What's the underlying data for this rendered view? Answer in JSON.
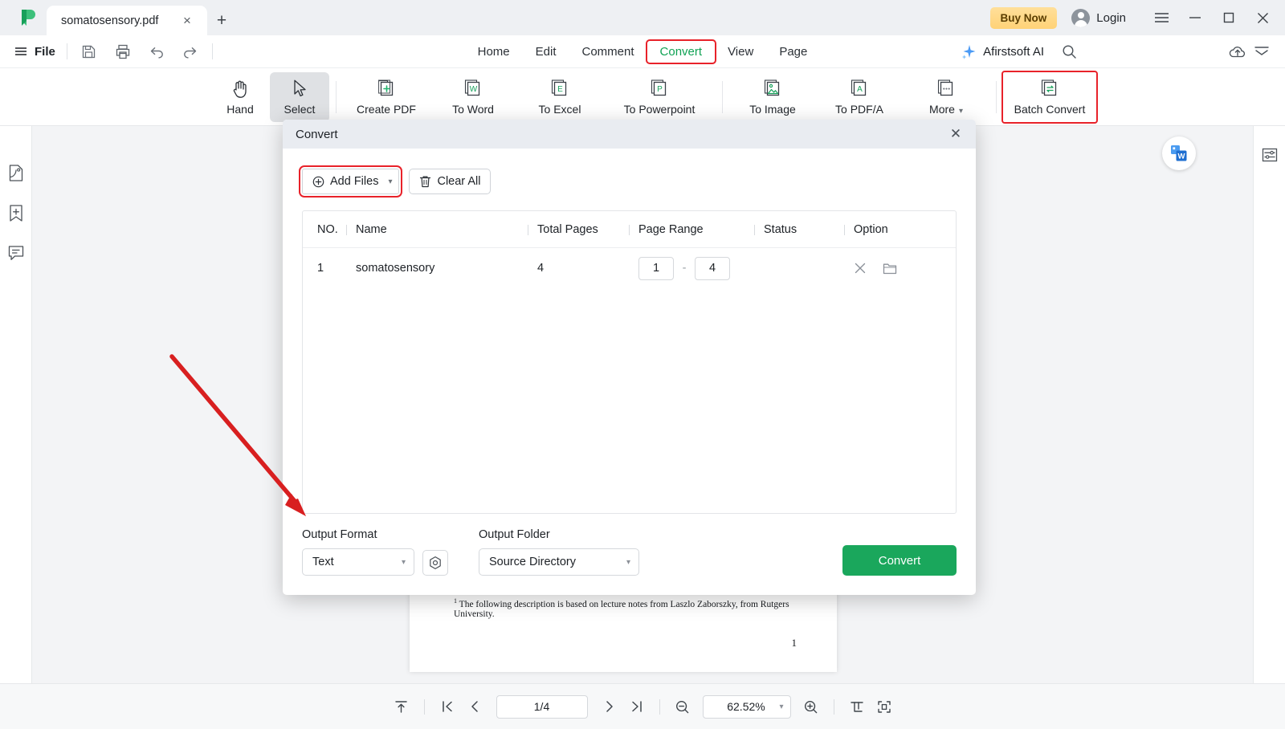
{
  "titlebar": {
    "logo_name": "app-logo",
    "tab": {
      "title": "somatosensory.pdf",
      "close_label": "×"
    },
    "new_tab_label": "+",
    "buy_now": "Buy Now",
    "login": "Login",
    "window_controls": {
      "menu": "≡",
      "minimize": "−",
      "maximize": "□",
      "close": "✕"
    }
  },
  "menubar": {
    "file_label": "File",
    "quick_actions": [
      "save-icon",
      "print-icon",
      "undo-icon",
      "redo-icon"
    ],
    "tabs": [
      {
        "label": "Home",
        "active": false
      },
      {
        "label": "Edit",
        "active": false
      },
      {
        "label": "Comment",
        "active": false
      },
      {
        "label": "Convert",
        "active": true,
        "highlight": true
      },
      {
        "label": "View",
        "active": false
      },
      {
        "label": "Page",
        "active": false
      }
    ],
    "ai_label": "Afirstsoft AI",
    "right_icons": [
      "search-icon",
      "cloud-upload-icon",
      "collapse-ribbon-icon"
    ],
    "accent_green": "#10a254",
    "highlight_red": "#e8222a"
  },
  "ribbon": {
    "items": [
      {
        "label": "Hand",
        "icon": "hand-icon",
        "selected": false,
        "highlight": false
      },
      {
        "label": "Select",
        "icon": "cursor-icon",
        "selected": true,
        "highlight": false
      },
      {
        "label": "Create PDF",
        "icon": "create-pdf-icon",
        "selected": false,
        "highlight": false
      },
      {
        "label": "To Word",
        "icon": "to-word-icon",
        "selected": false,
        "highlight": false
      },
      {
        "label": "To Excel",
        "icon": "to-excel-icon",
        "selected": false,
        "highlight": false
      },
      {
        "label": "To Powerpoint",
        "icon": "to-powerpoint-icon",
        "selected": false,
        "highlight": false
      },
      {
        "label": "To Image",
        "icon": "to-image-icon",
        "selected": false,
        "highlight": false
      },
      {
        "label": "To PDF/A",
        "icon": "to-pdfa-icon",
        "selected": false,
        "highlight": false
      },
      {
        "label": "More",
        "icon": "more-icon",
        "selected": false,
        "highlight": false,
        "caret": "▾"
      },
      {
        "label": "Batch Convert",
        "icon": "batch-convert-icon",
        "selected": false,
        "highlight": true
      }
    ]
  },
  "left_rail": {
    "items": [
      "thumbnail-icon",
      "bookmark-icon",
      "comment-icon"
    ]
  },
  "right_rail": {
    "items": [
      "properties-panel-icon"
    ]
  },
  "document": {
    "footnote_marker": "1",
    "footnote": "The following description is based on lecture notes from Laszlo Zaborszky, from Rutgers University.",
    "page_number": "1",
    "floating_badge": "word-convert-badge"
  },
  "dialog": {
    "title": "Convert",
    "close_label": "✕",
    "add_files": {
      "label": "Add Files",
      "icon": "plus-circle-icon",
      "caret": "▾",
      "highlight": true
    },
    "clear_all": {
      "label": "Clear All",
      "icon": "trash-icon"
    },
    "table": {
      "columns": [
        "NO.",
        "Name",
        "Total Pages",
        "Page Range",
        "Status",
        "Option"
      ],
      "rows": [
        {
          "no": "1",
          "name": "somatosensory",
          "total_pages": "4",
          "range_from": "1",
          "range_sep": "-",
          "range_to": "4",
          "status": "",
          "options": [
            "remove-icon",
            "open-folder-icon"
          ]
        }
      ]
    },
    "output_format": {
      "label": "Output Format",
      "value": "Text",
      "caret": "▾"
    },
    "format_settings_icon": "settings-gear-icon",
    "output_folder": {
      "label": "Output Folder",
      "value": "Source Directory",
      "caret": "▾"
    },
    "convert_button": {
      "label": "Convert",
      "color": "#1aa75c"
    }
  },
  "annotation": {
    "arrow_color": "#d81f20",
    "name": "red-pointer-arrow"
  },
  "statusbar": {
    "fit_top_icon": "scroll-to-top-icon",
    "first_page_icon": "first-page-icon",
    "prev_page_icon": "previous-page-icon",
    "page_value": "1/4",
    "next_page_icon": "next-page-icon",
    "last_page_icon": "last-page-icon",
    "zoom_out_icon": "zoom-out-icon",
    "zoom_value": "62.52%",
    "zoom_caret": "▾",
    "zoom_in_icon": "zoom-in-icon",
    "fit_width_icon": "fit-width-icon",
    "fit_page_icon": "fit-page-icon"
  }
}
